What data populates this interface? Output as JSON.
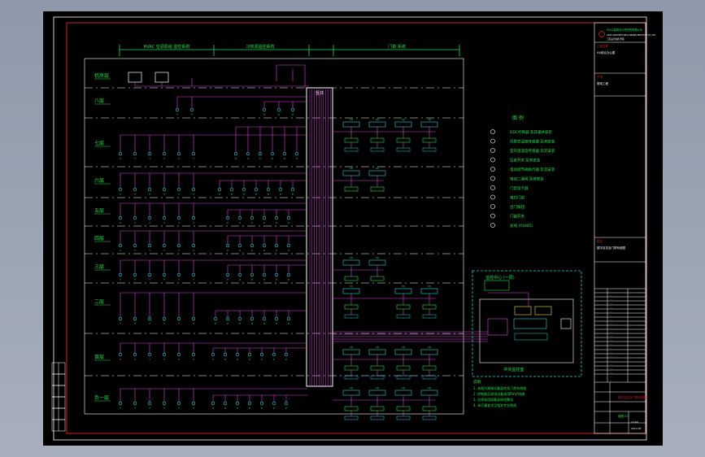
{
  "viewport": {
    "background": "#9aa3b2",
    "sheet_color": "#000000"
  },
  "colors": {
    "frame_red": "#d11f1f",
    "white": "#ffffff",
    "green": "#22e04a",
    "magenta": "#e040e0",
    "cyan": "#20d8d8",
    "yellow": "#e8e040"
  },
  "floors": {
    "labels": [
      "机房层",
      "八层",
      "七层",
      "六层",
      "五层",
      "四层",
      "三层",
      "二层",
      "首层",
      "负一层"
    ]
  },
  "dimension_labels": [
    "HVAC 空调机组 监控系统",
    "冷热源监控系统",
    "门禁 系统"
  ],
  "riser_label": "竖井",
  "legend": {
    "title": "图  例",
    "items": [
      {
        "icon": "ddc-controller-icon",
        "label": "DDC控制器 及其箱体安装"
      },
      {
        "icon": "temp-sensor-icon",
        "label": "风管式温度传感器 及其安装"
      },
      {
        "icon": "humidity-sensor-icon",
        "label": "室内温湿度传感器 及其安装"
      },
      {
        "icon": "pressure-switch-icon",
        "label": "压差开关 及其安装"
      },
      {
        "icon": "actuator-icon",
        "label": "电动调节阀执行器 及其安装"
      },
      {
        "icon": "valve-icon",
        "label": "电动二通阀 及其安装"
      },
      {
        "icon": "card-reader-icon",
        "label": "门禁读卡器"
      },
      {
        "icon": "door-lock-icon",
        "label": "电控门锁"
      },
      {
        "icon": "exit-button-icon",
        "label": "出门按钮"
      },
      {
        "icon": "door-sensor-icon",
        "label": "门磁开关"
      },
      {
        "icon": "bus-line-icon",
        "label": "总线 (RS485)"
      }
    ]
  },
  "control_room": {
    "title": "监控中心 (一层)",
    "footer": "中央监控室"
  },
  "notes": {
    "title": "说明:",
    "lines": [
      "1. 本图为建筑设备监控及门禁系统图",
      "2. 控制器至现场设备采用RVVP线缆",
      "3. 总线采用屏蔽双绞线敷设",
      "4. 未尽事宜详见相关专业图纸"
    ]
  },
  "title_block": {
    "company": "XXXX建筑设计研究院有限公司",
    "company_en": "XXXX ARCHITECTURAL DESIGN INSTITUTE CO.,LTD",
    "qualification": "工程设计资质 甲级",
    "project_label": "工程名称",
    "project": "XX综合办公楼",
    "sub_label": "子项",
    "sub": "弱电工程",
    "drawing_title_label": "图名",
    "drawing_title": "楼宇自控及门禁系统图",
    "drawing_no": "弱施-03",
    "scale": "1:100",
    "date": "2012.05"
  }
}
